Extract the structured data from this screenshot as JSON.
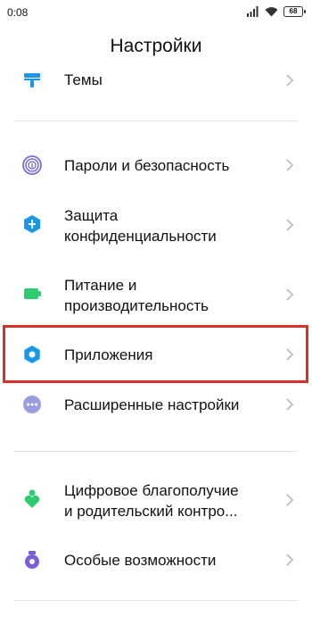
{
  "status_bar": {
    "time": "0:08",
    "battery_level": "68",
    "icons": [
      "signal-icon",
      "wifi-icon",
      "battery-icon"
    ]
  },
  "header": {
    "title": "Настройки"
  },
  "settings": [
    {
      "id": "themes",
      "label_lines": [
        "Темы"
      ],
      "icon": "themes-icon",
      "icon_color": "#1a96e8"
    },
    {
      "id": "passwords",
      "label_lines": [
        "Пароли и безопасность"
      ],
      "icon": "fingerprint-icon",
      "icon_color": "#7a6fd8"
    },
    {
      "id": "privacy",
      "label_lines": [
        "Защита",
        "конфиденциальности"
      ],
      "icon": "privacy-shield-icon",
      "icon_color": "#1a96e8"
    },
    {
      "id": "battery",
      "label_lines": [
        "Питание и",
        "производительность"
      ],
      "icon": "battery-performance-icon",
      "icon_color": "#2ecc71"
    },
    {
      "id": "apps",
      "label_lines": [
        "Приложения"
      ],
      "icon": "apps-gear-icon",
      "icon_color": "#1a96e8"
    },
    {
      "id": "advanced",
      "label_lines": [
        "Расширенные настройки"
      ],
      "icon": "more-dots-icon",
      "icon_color": "#9a9ee0"
    },
    {
      "id": "wellbeing",
      "label_lines": [
        "Цифровое благополучие",
        "и родительский контро..."
      ],
      "icon": "wellbeing-icon",
      "icon_color": "#2ecc71"
    },
    {
      "id": "accessibility",
      "label_lines": [
        "Особые возможности"
      ],
      "icon": "accessibility-icon",
      "icon_color": "#7a5fd8"
    }
  ],
  "highlight": {
    "target": "apps",
    "color": "#d9302c"
  }
}
